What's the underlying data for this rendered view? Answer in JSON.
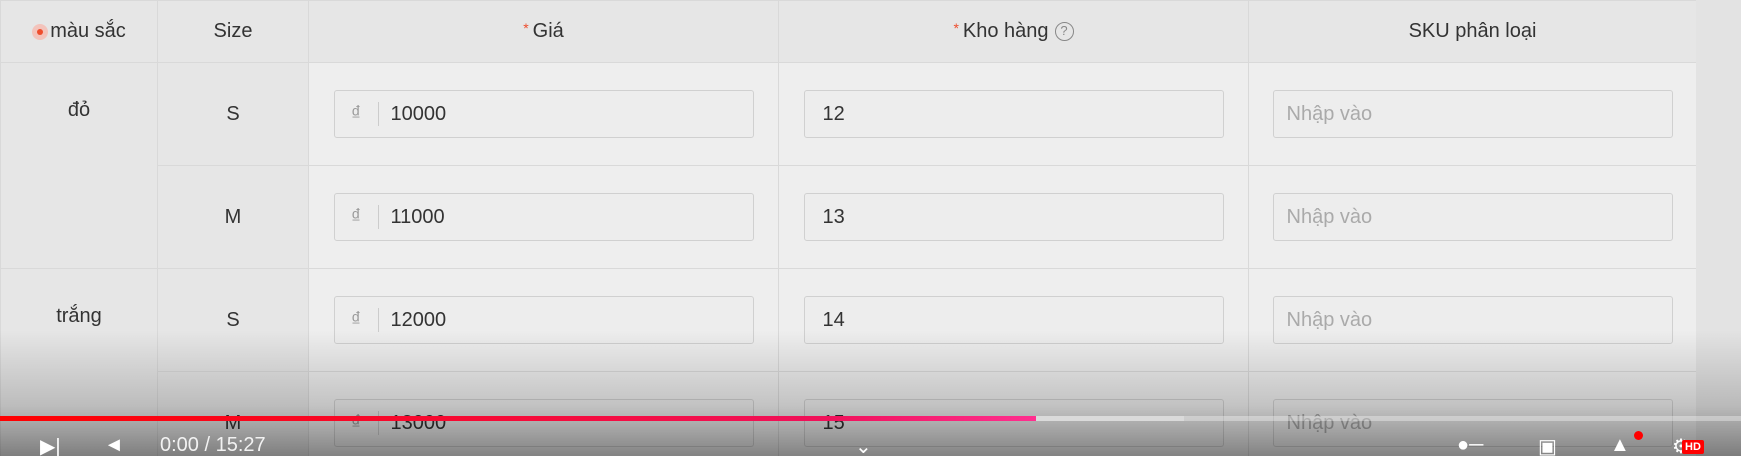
{
  "table": {
    "headers": {
      "color": "màu sắc",
      "size": "Size",
      "price": "Giá",
      "stock": "Kho hàng",
      "sku": "SKU phân loại"
    },
    "currency_symbol": "₫",
    "sku_placeholder": "Nhập vào",
    "groups": [
      {
        "color": "đỏ",
        "rows": [
          {
            "size": "S",
            "price": "10000",
            "stock": "12"
          },
          {
            "size": "M",
            "price": "11000",
            "stock": "13"
          }
        ]
      },
      {
        "color": "trắng",
        "rows": [
          {
            "size": "S",
            "price": "12000",
            "stock": "14"
          },
          {
            "size": "M",
            "price": "13000",
            "stock": "15"
          }
        ]
      }
    ]
  },
  "video_player": {
    "time": "0:00 / 15:27",
    "progress_fraction": 0.595,
    "buffered_fraction": 0.68,
    "hd_label": "HD",
    "icons": [
      "next-icon",
      "volume-icon",
      "chevron-down-icon",
      "autoplay-toggle-icon",
      "subtitles-icon",
      "settings-icon",
      "fullscreen-icon"
    ]
  },
  "colors": {
    "accent": "#ee4d2d",
    "progress": "#ff0000"
  }
}
